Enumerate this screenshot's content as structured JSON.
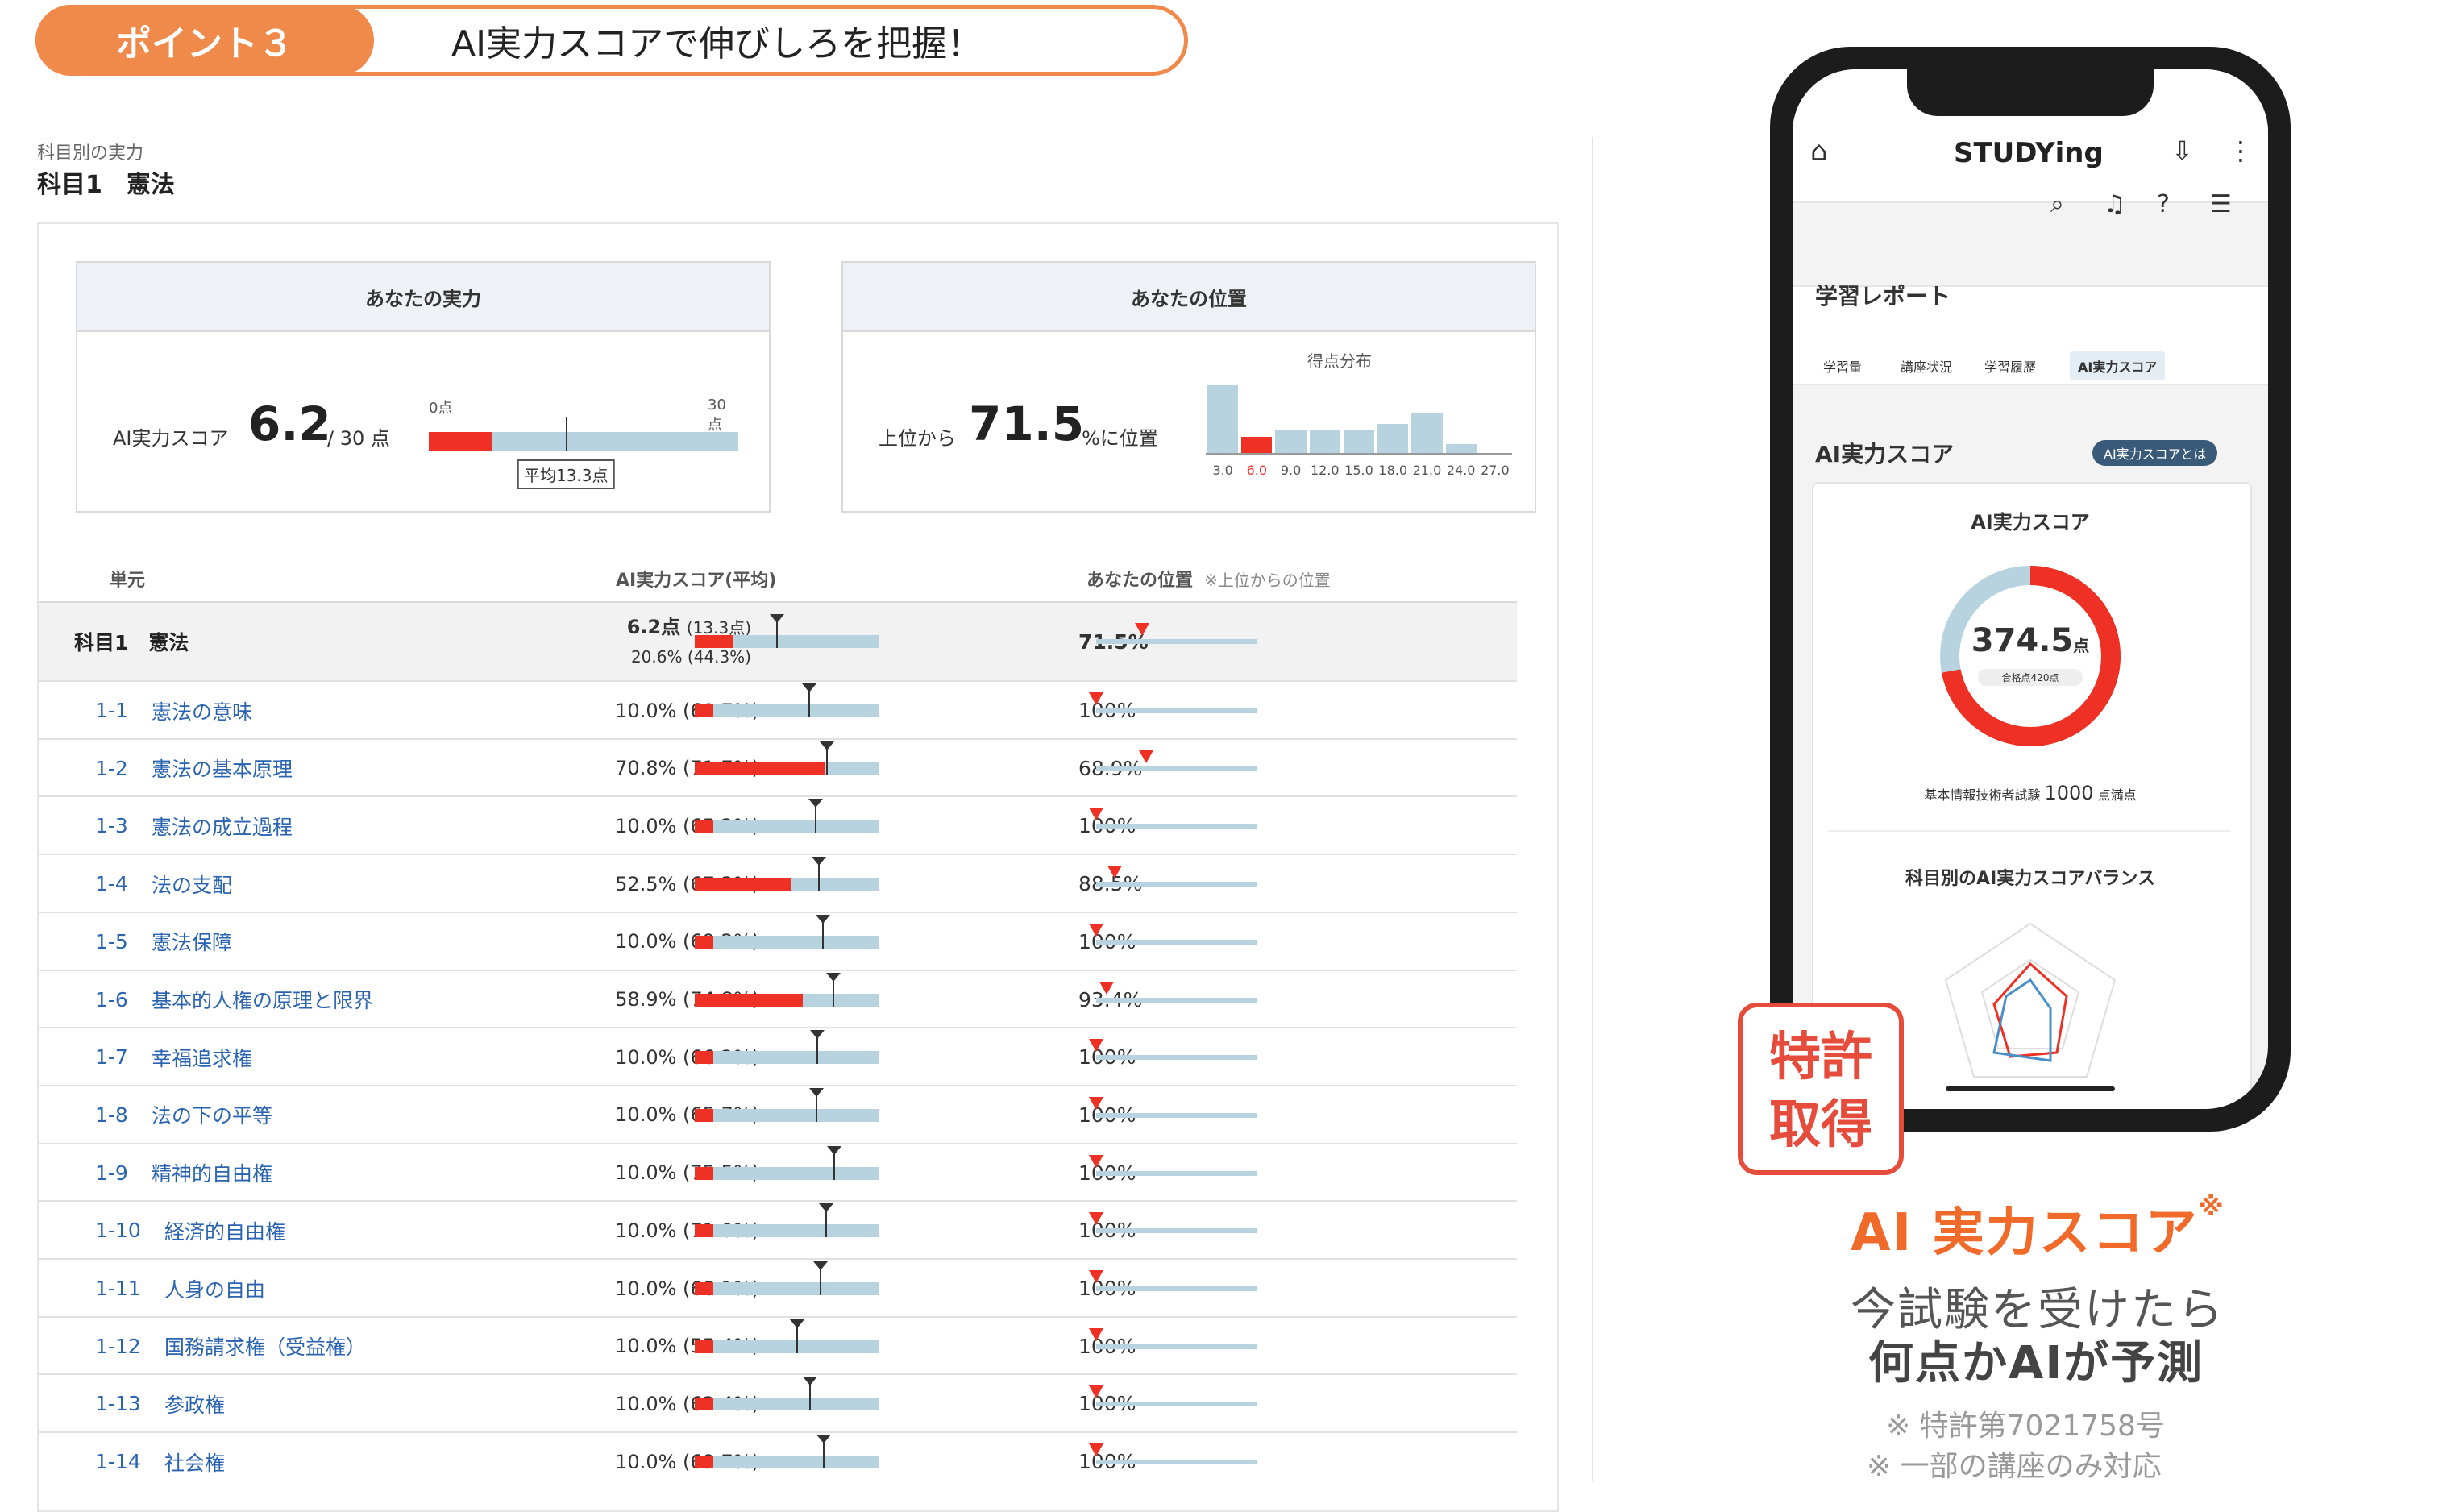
{
  "banner": {
    "tab": "ポイント３",
    "title": "AI実力スコアで伸びしろを把握！"
  },
  "breadcrumb": "科目別の実力",
  "subject": "科目1　憲法",
  "ability": {
    "header": "あなたの実力",
    "label": "AI実力スコア",
    "score": "6.2",
    "max": "/ 30 点",
    "min_tick": "0点",
    "max_tick": "30点",
    "avg_label": "平均13.3点",
    "score_value": 6.2,
    "avg_value": 13.3,
    "max_value": 30
  },
  "position": {
    "header": "あなたの位置",
    "prefix": "上位から",
    "value": "71.5",
    "suffix": "%に位置",
    "dist_label": "得点分布",
    "dist_ticks": [
      "3.0",
      "6.0",
      "9.0",
      "12.0",
      "15.0",
      "18.0",
      "21.0",
      "24.0",
      "27.0"
    ],
    "dist_bins": [
      60,
      14,
      20,
      20,
      20,
      26,
      36,
      8,
      0
    ],
    "highlight_index": 1
  },
  "table": {
    "headers": {
      "unit": "単元",
      "score": "AI実力スコア(平均)",
      "pos": "あなたの位置",
      "pos_note": "※上位からの位置"
    },
    "summary": {
      "name": "科目1　憲法",
      "score": "6.2点",
      "score_avg": "(13.3点)",
      "pct": "20.6% (44.3%)",
      "pos": "71.5%",
      "fill": 20.6,
      "avg": 44.3,
      "pos_value": 71.5
    },
    "rows": [
      {
        "code": "1-1",
        "name": "憲法の意味",
        "score": "10.0% (61.7%)",
        "pos": "100%",
        "fill": 10,
        "avg": 61.7,
        "pos_value": 100
      },
      {
        "code": "1-2",
        "name": "憲法の基本原理",
        "score": "70.8% (71.7%)",
        "pos": "68.9%",
        "fill": 70.8,
        "avg": 71.7,
        "pos_value": 68.9
      },
      {
        "code": "1-3",
        "name": "憲法の成立過程",
        "score": "10.0% (65.2%)",
        "pos": "100%",
        "fill": 10,
        "avg": 65.2,
        "pos_value": 100
      },
      {
        "code": "1-4",
        "name": "法の支配",
        "score": "52.5% (67.3%)",
        "pos": "88.5%",
        "fill": 52.5,
        "avg": 67.3,
        "pos_value": 88.5
      },
      {
        "code": "1-5",
        "name": "憲法保障",
        "score": "10.0% (69.2%)",
        "pos": "100%",
        "fill": 10,
        "avg": 69.2,
        "pos_value": 100
      },
      {
        "code": "1-6",
        "name": "基本的人権の原理と限界",
        "score": "58.9% (74.8%)",
        "pos": "93.4%",
        "fill": 58.9,
        "avg": 74.8,
        "pos_value": 93.4
      },
      {
        "code": "1-7",
        "name": "幸福追求権",
        "score": "10.0% (66.2%)",
        "pos": "100%",
        "fill": 10,
        "avg": 66.2,
        "pos_value": 100
      },
      {
        "code": "1-8",
        "name": "法の下の平等",
        "score": "10.0% (65.7%)",
        "pos": "100%",
        "fill": 10,
        "avg": 65.7,
        "pos_value": 100
      },
      {
        "code": "1-9",
        "name": "精神的自由権",
        "score": "10.0% (75.5%)",
        "pos": "100%",
        "fill": 10,
        "avg": 75.5,
        "pos_value": 100
      },
      {
        "code": "1-10",
        "name": "経済的自由権",
        "score": "10.0% (71.0%)",
        "pos": "100%",
        "fill": 10,
        "avg": 71.0,
        "pos_value": 100
      },
      {
        "code": "1-11",
        "name": "人身の自由",
        "score": "10.0% (68.1%)",
        "pos": "100%",
        "fill": 10,
        "avg": 68.1,
        "pos_value": 100
      },
      {
        "code": "1-12",
        "name": "国務請求権（受益権）",
        "score": "10.0% (55.4%)",
        "pos": "100%",
        "fill": 10,
        "avg": 55.4,
        "pos_value": 100
      },
      {
        "code": "1-13",
        "name": "参政権",
        "score": "10.0% (62.4%)",
        "pos": "100%",
        "fill": 10,
        "avg": 62.4,
        "pos_value": 100
      },
      {
        "code": "1-14",
        "name": "社会権",
        "score": "10.0% (69.7%)",
        "pos": "100%",
        "fill": 10,
        "avg": 69.7,
        "pos_value": 100
      }
    ]
  },
  "phone": {
    "logo": "STUDYing",
    "report_title": "学習レポート",
    "tabs": [
      "学習量",
      "講座状況",
      "学習履歴",
      "AI実力スコア"
    ],
    "section": "AI実力スコア",
    "pill": "AI実力スコアとは",
    "card_title": "AI実力スコア",
    "donut_value": "374.5",
    "donut_unit": "点",
    "donut_note": "合格点420点",
    "donut_fraction": 0.72,
    "exam_note": "基本情報技術者試験",
    "exam_total": "1000",
    "exam_unit": "点満点",
    "balance_title": "科目別のAI実力スコアバランス"
  },
  "stamp": {
    "line1": "特許",
    "line2": "取得"
  },
  "promo": {
    "title": "AI 実力スコア",
    "title_mark": "※",
    "sub1": "今試験を受けたら",
    "sub2": "何点かAIが予測",
    "note1": "※ 特許第7021758号",
    "note2": "※ 一部の講座のみ対応"
  },
  "colors": {
    "accent": "#f08a4b",
    "red": "#ee3124",
    "bar": "#b8d3e0",
    "link": "#2a64b0"
  }
}
